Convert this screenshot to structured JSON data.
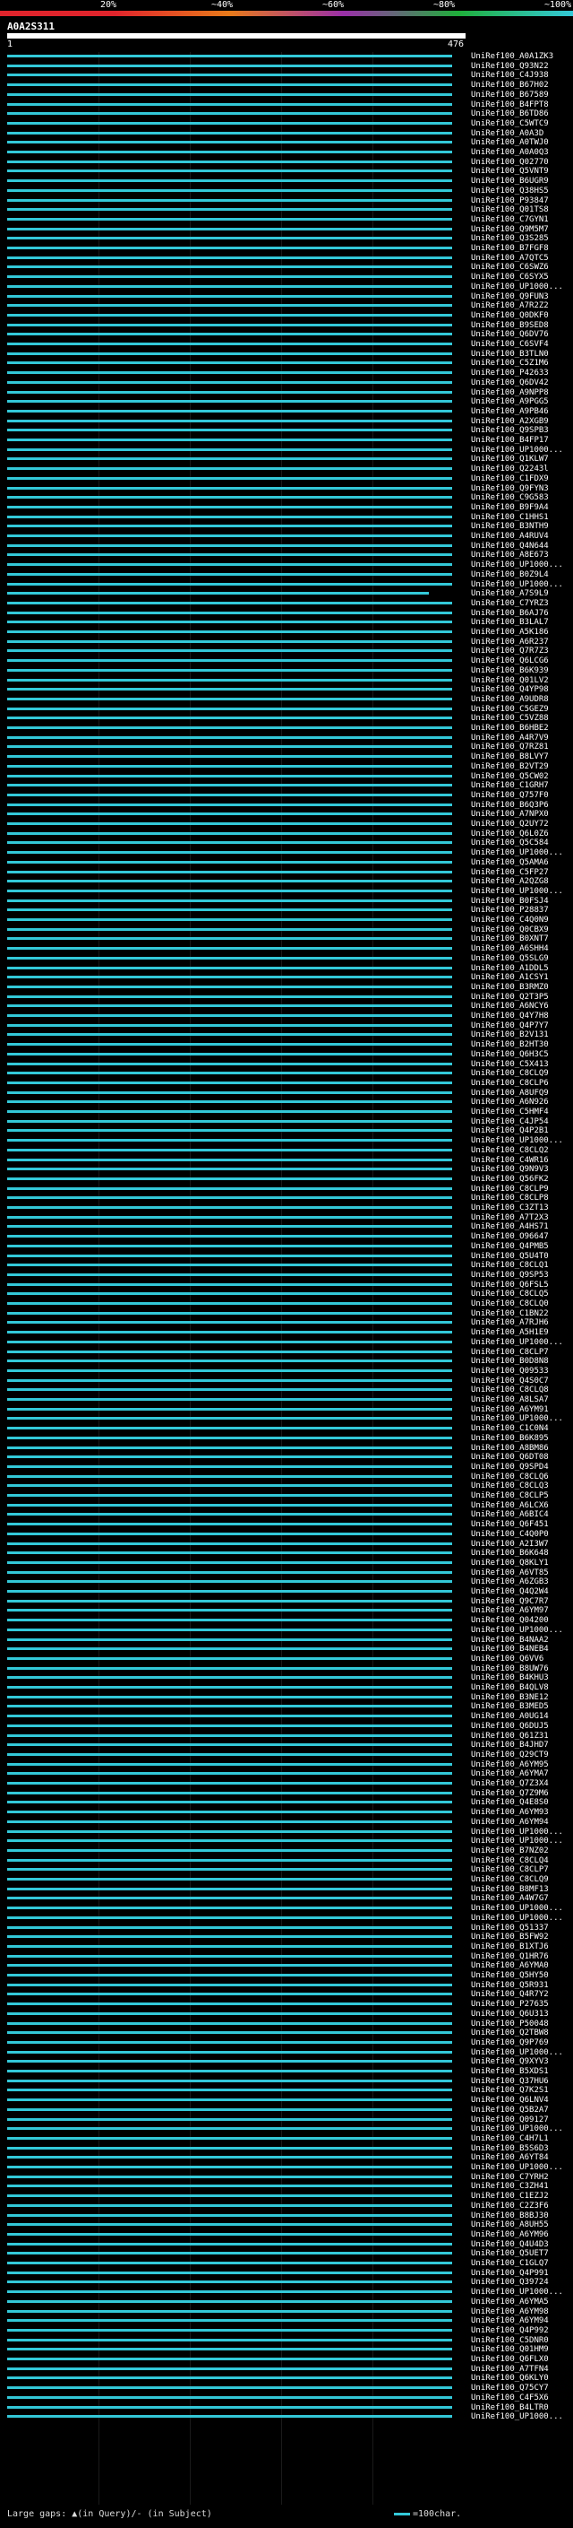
{
  "scale": {
    "labels": [
      "20%",
      "~40%",
      "~60%",
      "~80%",
      "~100%"
    ],
    "colors": [
      "#e0242c",
      "#e87a1a",
      "#9a2fa8",
      "#1fae3a",
      "#33c8d8"
    ]
  },
  "query": {
    "id": "A0A2S311",
    "start_label": "1",
    "end_label": "476"
  },
  "hits": [
    {
      "label": "UniRef100_A0A1ZK3",
      "end": 0.97
    },
    {
      "label": "UniRef100_Q93N22",
      "end": 0.97
    },
    {
      "label": "UniRef100_C4J938",
      "end": 0.97
    },
    {
      "label": "UniRef100_B67H02",
      "end": 0.97
    },
    {
      "label": "UniRef100_B67589",
      "end": 0.97
    },
    {
      "label": "UniRef100_B4FPT8",
      "end": 0.97
    },
    {
      "label": "UniRef100_B6TD86",
      "end": 0.97
    },
    {
      "label": "UniRef100_C5WTC9",
      "end": 0.97
    },
    {
      "label": "UniRef100_A0A3D",
      "end": 0.97
    },
    {
      "label": "UniRef100_A0TWJ0",
      "end": 0.97
    },
    {
      "label": "UniRef100_A0A0Q3",
      "end": 0.97
    },
    {
      "label": "UniRef100_Q02770",
      "end": 0.97
    },
    {
      "label": "UniRef100_Q5VNT9",
      "end": 0.97
    },
    {
      "label": "UniRef100_B6UGR9",
      "end": 0.97
    },
    {
      "label": "UniRef100_Q38HS5",
      "end": 0.97
    },
    {
      "label": "UniRef100_P93847",
      "end": 0.97
    },
    {
      "label": "UniRef100_Q01TS8",
      "end": 0.97
    },
    {
      "label": "UniRef100_C7GYN1",
      "end": 0.97
    },
    {
      "label": "UniRef100_Q9M5M7",
      "end": 0.97
    },
    {
      "label": "UniRef100_Q3S285",
      "end": 0.97
    },
    {
      "label": "UniRef100_B7FGF8",
      "end": 0.97
    },
    {
      "label": "UniRef100_A7QTC5",
      "end": 0.97
    },
    {
      "label": "UniRef100_C6SWZ6",
      "end": 0.97
    },
    {
      "label": "UniRef100_C6SYX5",
      "end": 0.97
    },
    {
      "label": "UniRef100_UP1000...",
      "end": 0.97
    },
    {
      "label": "UniRef100_Q9FUN3",
      "end": 0.97
    },
    {
      "label": "UniRef100_A7R2Z2",
      "end": 0.97
    },
    {
      "label": "UniRef100_Q0DKF0",
      "end": 0.97
    },
    {
      "label": "UniRef100_B9SED8",
      "end": 0.97
    },
    {
      "label": "UniRef100_Q6DV76",
      "end": 0.97
    },
    {
      "label": "UniRef100_C6SVF4",
      "end": 0.97
    },
    {
      "label": "UniRef100_B3TLN0",
      "end": 0.97
    },
    {
      "label": "UniRef100_C5Z1M6",
      "end": 0.97
    },
    {
      "label": "UniRef100_P42633",
      "end": 0.97
    },
    {
      "label": "UniRef100_Q6DV42",
      "end": 0.97
    },
    {
      "label": "UniRef100_A9NPP8",
      "end": 0.97
    },
    {
      "label": "UniRef100_A9PGG5",
      "end": 0.97
    },
    {
      "label": "UniRef100_A9PB46",
      "end": 0.97
    },
    {
      "label": "UniRef100_A2XGB9",
      "end": 0.97
    },
    {
      "label": "UniRef100_Q9SPB3",
      "end": 0.97
    },
    {
      "label": "UniRef100_B4FP17",
      "end": 0.97
    },
    {
      "label": "UniRef100_UP1000...",
      "end": 0.97
    },
    {
      "label": "UniRef100_Q1KLW7",
      "end": 0.97
    },
    {
      "label": "UniRef100_Q2243l",
      "end": 0.97
    },
    {
      "label": "UniRef100_C1FDX9",
      "end": 0.97
    },
    {
      "label": "UniRef100_Q9FYN3",
      "end": 0.97
    },
    {
      "label": "UniRef100_C9G583",
      "end": 0.97
    },
    {
      "label": "UniRef100_B9F9A4",
      "end": 0.97
    },
    {
      "label": "UniRef100_C1HHS1",
      "end": 0.97
    },
    {
      "label": "UniRef100_B3NTH9",
      "end": 0.97
    },
    {
      "label": "UniRef100_A4RUV4",
      "end": 0.97
    },
    {
      "label": "UniRef100_Q4N644",
      "end": 0.97
    },
    {
      "label": "UniRef100_A8E673",
      "end": 0.97
    },
    {
      "label": "UniRef100_UP1000...",
      "end": 0.97
    },
    {
      "label": "UniRef100_B0Z9L4",
      "end": 0.97
    },
    {
      "label": "UniRef100_UP1000...",
      "end": 0.97
    },
    {
      "label": "UniRef100_A7S9L9",
      "end": 0.92
    },
    {
      "label": "UniRef100_C7YRZ3",
      "end": 0.97
    },
    {
      "label": "UniRef100_B6AJ76",
      "end": 0.97
    },
    {
      "label": "UniRef100_B3LAL7",
      "end": 0.97
    },
    {
      "label": "UniRef100_A5K186",
      "end": 0.97
    },
    {
      "label": "UniRef100_A6R237",
      "end": 0.97
    },
    {
      "label": "UniRef100_Q7R7Z3",
      "end": 0.97
    },
    {
      "label": "UniRef100_Q6LCG6",
      "end": 0.97
    },
    {
      "label": "UniRef100_B6K939",
      "end": 0.97
    },
    {
      "label": "UniRef100_Q01LV2",
      "end": 0.97
    },
    {
      "label": "UniRef100_Q4YP98",
      "end": 0.97
    },
    {
      "label": "UniRef100_A9UDR8",
      "end": 0.97
    },
    {
      "label": "UniRef100_C5GEZ9",
      "end": 0.97
    },
    {
      "label": "UniRef100_C5VZ88",
      "end": 0.97
    },
    {
      "label": "UniRef100_B6HBE2",
      "end": 0.97
    },
    {
      "label": "UniRef100_A4R7V9",
      "end": 0.97
    },
    {
      "label": "UniRef100_Q7RZ81",
      "end": 0.97
    },
    {
      "label": "UniRef100_B8LVY7",
      "end": 0.97
    },
    {
      "label": "UniRef100_B2VT29",
      "end": 0.97
    },
    {
      "label": "UniRef100_Q5CW02",
      "end": 0.97
    },
    {
      "label": "UniRef100_C1GRH7",
      "end": 0.97
    },
    {
      "label": "UniRef100_Q757F0",
      "end": 0.97
    },
    {
      "label": "UniRef100_B6Q3P6",
      "end": 0.97
    },
    {
      "label": "UniRef100_A7NPX0",
      "end": 0.97
    },
    {
      "label": "UniRef100_Q2UY72",
      "end": 0.97
    },
    {
      "label": "UniRef100_Q6L0Z6",
      "end": 0.97
    },
    {
      "label": "UniRef100_Q5C584",
      "end": 0.97
    },
    {
      "label": "UniRef100_UP1000...",
      "end": 0.97
    },
    {
      "label": "UniRef100_Q5AMA6",
      "end": 0.97
    },
    {
      "label": "UniRef100_C5FP27",
      "end": 0.97
    },
    {
      "label": "UniRef100_A2QZG8",
      "end": 0.97
    },
    {
      "label": "UniRef100_UP1000...",
      "end": 0.97
    },
    {
      "label": "UniRef100_B0FSJ4",
      "end": 0.97
    },
    {
      "label": "UniRef100_P28837",
      "end": 0.97
    },
    {
      "label": "UniRef100_C4Q0N9",
      "end": 0.97
    },
    {
      "label": "UniRef100_Q0CBX9",
      "end": 0.97
    },
    {
      "label": "UniRef100_B0XNT7",
      "end": 0.97
    },
    {
      "label": "UniRef100_A6SHH4",
      "end": 0.97
    },
    {
      "label": "UniRef100_Q5SLG9",
      "end": 0.97
    },
    {
      "label": "UniRef100_A1DDL5",
      "end": 0.97
    },
    {
      "label": "UniRef100_A1CSY1",
      "end": 0.97
    },
    {
      "label": "UniRef100_B3RMZ0",
      "end": 0.97
    },
    {
      "label": "UniRef100_Q2T3P5",
      "end": 0.97
    },
    {
      "label": "UniRef100_A6NCY6",
      "end": 0.97
    },
    {
      "label": "UniRef100_Q4Y7H8",
      "end": 0.97
    },
    {
      "label": "UniRef100_Q4P7Y7",
      "end": 0.97
    },
    {
      "label": "UniRef100_B2V131",
      "end": 0.97
    },
    {
      "label": "UniRef100_B2HT30",
      "end": 0.97
    },
    {
      "label": "UniRef100_Q6H3C5",
      "end": 0.97
    },
    {
      "label": "UniRef100_C5X413",
      "end": 0.97
    },
    {
      "label": "UniRef100_C8CLQ9",
      "end": 0.97
    },
    {
      "label": "UniRef100_C8CLP6",
      "end": 0.97
    },
    {
      "label": "UniRef100_A8UFQ9",
      "end": 0.97
    },
    {
      "label": "UniRef100_A6N926",
      "end": 0.97
    },
    {
      "label": "UniRef100_C5HMF4",
      "end": 0.97
    },
    {
      "label": "UniRef100_C4JP54",
      "end": 0.97
    },
    {
      "label": "UniRef100_Q4P2B1",
      "end": 0.97
    },
    {
      "label": "UniRef100_UP1000...",
      "end": 0.97
    },
    {
      "label": "UniRef100_C8CLQ2",
      "end": 0.97
    },
    {
      "label": "UniRef100_C4WR16",
      "end": 0.97
    },
    {
      "label": "UniRef100_Q9N9V3",
      "end": 0.97
    },
    {
      "label": "UniRef100_Q56FK2",
      "end": 0.97
    },
    {
      "label": "UniRef100_C8CLP9",
      "end": 0.97
    },
    {
      "label": "UniRef100_C8CLP8",
      "end": 0.97
    },
    {
      "label": "UniRef100_C3ZT13",
      "end": 0.97
    },
    {
      "label": "UniRef100_A7T2X3",
      "end": 0.97
    },
    {
      "label": "UniRef100_A4HS71",
      "end": 0.97
    },
    {
      "label": "UniRef100_O96647",
      "end": 0.97
    },
    {
      "label": "UniRef100_Q4PMB5",
      "end": 0.97
    },
    {
      "label": "UniRef100_Q5U4T0",
      "end": 0.97
    },
    {
      "label": "UniRef100_C8CLQ1",
      "end": 0.97
    },
    {
      "label": "UniRef100_Q9SP53",
      "end": 0.97
    },
    {
      "label": "UniRef100_Q6FSL5",
      "end": 0.97
    },
    {
      "label": "UniRef100_C8CLQ5",
      "end": 0.97
    },
    {
      "label": "UniRef100_C8CLQ0",
      "end": 0.97
    },
    {
      "label": "UniRef100_C1BN22",
      "end": 0.97
    },
    {
      "label": "UniRef100_A7RJH6",
      "end": 0.97
    },
    {
      "label": "UniRef100_A5H1E9",
      "end": 0.97
    },
    {
      "label": "UniRef100_UP1000...",
      "end": 0.97
    },
    {
      "label": "UniRef100_C8CLP7",
      "end": 0.97
    },
    {
      "label": "UniRef100_B0D8N8",
      "end": 0.97
    },
    {
      "label": "UniRef100_Q09533",
      "end": 0.97
    },
    {
      "label": "UniRef100_Q4S0C7",
      "end": 0.97
    },
    {
      "label": "UniRef100_C8CLQ8",
      "end": 0.97
    },
    {
      "label": "UniRef100_A8LSA7",
      "end": 0.97
    },
    {
      "label": "UniRef100_A6YM91",
      "end": 0.97
    },
    {
      "label": "UniRef100_UP1000...",
      "end": 0.97
    },
    {
      "label": "UniRef100_C1C0N4",
      "end": 0.97
    },
    {
      "label": "UniRef100_B6K895",
      "end": 0.97
    },
    {
      "label": "UniRef100_A8BM86",
      "end": 0.97
    },
    {
      "label": "UniRef100_Q6DT08",
      "end": 0.97
    },
    {
      "label": "UniRef100_Q9SPD4",
      "end": 0.97
    },
    {
      "label": "UniRef100_C8CLQ6",
      "end": 0.97
    },
    {
      "label": "UniRef100_C8CLQ3",
      "end": 0.97
    },
    {
      "label": "UniRef100_C8CLP5",
      "end": 0.97
    },
    {
      "label": "UniRef100_A6LCX6",
      "end": 0.97
    },
    {
      "label": "UniRef100_A6BIC4",
      "end": 0.97
    },
    {
      "label": "UniRef100_Q6F451",
      "end": 0.97
    },
    {
      "label": "UniRef100_C4Q0P0",
      "end": 0.97
    },
    {
      "label": "UniRef100_A2I3W7",
      "end": 0.97
    },
    {
      "label": "UniRef100_B6K648",
      "end": 0.97
    },
    {
      "label": "UniRef100_Q8KLY1",
      "end": 0.97
    },
    {
      "label": "UniRef100_A6VT85",
      "end": 0.97
    },
    {
      "label": "UniRef100_A6ZGB3",
      "end": 0.97
    },
    {
      "label": "UniRef100_Q4Q2W4",
      "end": 0.97
    },
    {
      "label": "UniRef100_Q9C7R7",
      "end": 0.97
    },
    {
      "label": "UniRef100_A6YM97",
      "end": 0.97
    },
    {
      "label": "UniRef100_Q04200",
      "end": 0.97
    },
    {
      "label": "UniRef100_UP1000...",
      "end": 0.97
    },
    {
      "label": "UniRef100_B4NAA2",
      "end": 0.97
    },
    {
      "label": "UniRef100_B4NEB4",
      "end": 0.97
    },
    {
      "label": "UniRef100_Q6VV6",
      "end": 0.97
    },
    {
      "label": "UniRef100_B8UW76",
      "end": 0.97
    },
    {
      "label": "UniRef100_B4KHU3",
      "end": 0.97
    },
    {
      "label": "UniRef100_B4QLV8",
      "end": 0.97
    },
    {
      "label": "UniRef100_B3NE12",
      "end": 0.97
    },
    {
      "label": "UniRef100_B3MED5",
      "end": 0.97
    },
    {
      "label": "UniRef100_A0UG14",
      "end": 0.97
    },
    {
      "label": "UniRef100_Q6DUJ5",
      "end": 0.97
    },
    {
      "label": "UniRef100_Q61Z31",
      "end": 0.97
    },
    {
      "label": "UniRef100_B4JHD7",
      "end": 0.97
    },
    {
      "label": "UniRef100_Q29CT9",
      "end": 0.97
    },
    {
      "label": "UniRef100_A6YM95",
      "end": 0.97
    },
    {
      "label": "UniRef100_A6YMA7",
      "end": 0.97
    },
    {
      "label": "UniRef100_Q7Z3X4",
      "end": 0.97
    },
    {
      "label": "UniRef100_Q7Z9M6",
      "end": 0.97
    },
    {
      "label": "UniRef100_Q4E8S0",
      "end": 0.97
    },
    {
      "label": "UniRef100_A6YM93",
      "end": 0.97
    },
    {
      "label": "UniRef100_A6YM94",
      "end": 0.97
    },
    {
      "label": "UniRef100_UP1000...",
      "end": 0.97
    },
    {
      "label": "UniRef100_UP1000...",
      "end": 0.97
    },
    {
      "label": "UniRef100_B7NZ02",
      "end": 0.97
    },
    {
      "label": "UniRef100_C8CLQ4",
      "end": 0.97
    },
    {
      "label": "UniRef100_C8CLP7",
      "end": 0.97
    },
    {
      "label": "UniRef100_C8CLQ9",
      "end": 0.97
    },
    {
      "label": "UniRef100_B8MF13",
      "end": 0.97
    },
    {
      "label": "UniRef100_A4W7G7",
      "end": 0.97
    },
    {
      "label": "UniRef100_UP1000...",
      "end": 0.97
    },
    {
      "label": "UniRef100_UP1000...",
      "end": 0.97
    },
    {
      "label": "UniRef100_Q51337",
      "end": 0.97
    },
    {
      "label": "UniRef100_B5FW92",
      "end": 0.97
    },
    {
      "label": "UniRef100_B1XTJ6",
      "end": 0.97
    },
    {
      "label": "UniRef100_Q1HR76",
      "end": 0.97
    },
    {
      "label": "UniRef100_A6YMA0",
      "end": 0.97
    },
    {
      "label": "UniRef100_Q5HY50",
      "end": 0.97
    },
    {
      "label": "UniRef100_Q5R931",
      "end": 0.97
    },
    {
      "label": "UniRef100_Q4R7Y2",
      "end": 0.97
    },
    {
      "label": "UniRef100_P27635",
      "end": 0.97
    },
    {
      "label": "UniRef100_Q6U313",
      "end": 0.97
    },
    {
      "label": "UniRef100_P50048",
      "end": 0.97
    },
    {
      "label": "UniRef100_Q2TBW8",
      "end": 0.97
    },
    {
      "label": "UniRef100_Q9P769",
      "end": 0.97
    },
    {
      "label": "UniRef100_UP1000...",
      "end": 0.97
    },
    {
      "label": "UniRef100_Q9XYV3",
      "end": 0.97
    },
    {
      "label": "UniRef100_B5XDS1",
      "end": 0.97
    },
    {
      "label": "UniRef100_Q37HU6",
      "end": 0.97
    },
    {
      "label": "UniRef100_Q7K2S1",
      "end": 0.97
    },
    {
      "label": "UniRef100_Q6LNV4",
      "end": 0.97
    },
    {
      "label": "UniRef100_Q5B2A7",
      "end": 0.97
    },
    {
      "label": "UniRef100_Q09127",
      "end": 0.97
    },
    {
      "label": "UniRef100_UP1000...",
      "end": 0.97
    },
    {
      "label": "UniRef100_C4H7L1",
      "end": 0.97
    },
    {
      "label": "UniRef100_B5S6D3",
      "end": 0.97
    },
    {
      "label": "UniRef100_A6YT84",
      "end": 0.97
    },
    {
      "label": "UniRef100_UP1000...",
      "end": 0.97
    },
    {
      "label": "UniRef100_C7YRH2",
      "end": 0.97
    },
    {
      "label": "UniRef100_C3ZH41",
      "end": 0.97
    },
    {
      "label": "UniRef100_C1EZJ2",
      "end": 0.97
    },
    {
      "label": "UniRef100_C2Z3F6",
      "end": 0.97
    },
    {
      "label": "UniRef100_B8BJ30",
      "end": 0.97
    },
    {
      "label": "UniRef100_A8UH55",
      "end": 0.97
    },
    {
      "label": "UniRef100_A6YM96",
      "end": 0.97
    },
    {
      "label": "UniRef100_Q4U4D3",
      "end": 0.97
    },
    {
      "label": "UniRef100_Q5UET7",
      "end": 0.97
    },
    {
      "label": "UniRef100_C1GLQ7",
      "end": 0.97
    },
    {
      "label": "UniRef100_Q4P991",
      "end": 0.97
    },
    {
      "label": "UniRef100_Q39724",
      "end": 0.97
    },
    {
      "label": "UniRef100_UP1000...",
      "end": 0.97
    },
    {
      "label": "UniRef100_A6YMA5",
      "end": 0.97
    },
    {
      "label": "UniRef100_A6YM98",
      "end": 0.97
    },
    {
      "label": "UniRef100_A6YM94",
      "end": 0.97
    },
    {
      "label": "UniRef100_Q4P992",
      "end": 0.97
    },
    {
      "label": "UniRef100_C5DNR0",
      "end": 0.97
    },
    {
      "label": "UniRef100_Q01HM9",
      "end": 0.97
    },
    {
      "label": "UniRef100_Q6FLX0",
      "end": 0.97
    },
    {
      "label": "UniRef100_A7TFN4",
      "end": 0.97
    },
    {
      "label": "UniRef100_Q6KLY0",
      "end": 0.97
    },
    {
      "label": "UniRef100_Q75CY7",
      "end": 0.97
    },
    {
      "label": "UniRef100_C4F5X6",
      "end": 0.97
    },
    {
      "label": "UniRef100_B4LTR0",
      "end": 0.97
    },
    {
      "label": "UniRef100_UP1000...",
      "end": 0.97
    }
  ],
  "legend": {
    "left": "Large gaps: ▲(in Query)/- (in Subject)",
    "right": "=100char."
  }
}
